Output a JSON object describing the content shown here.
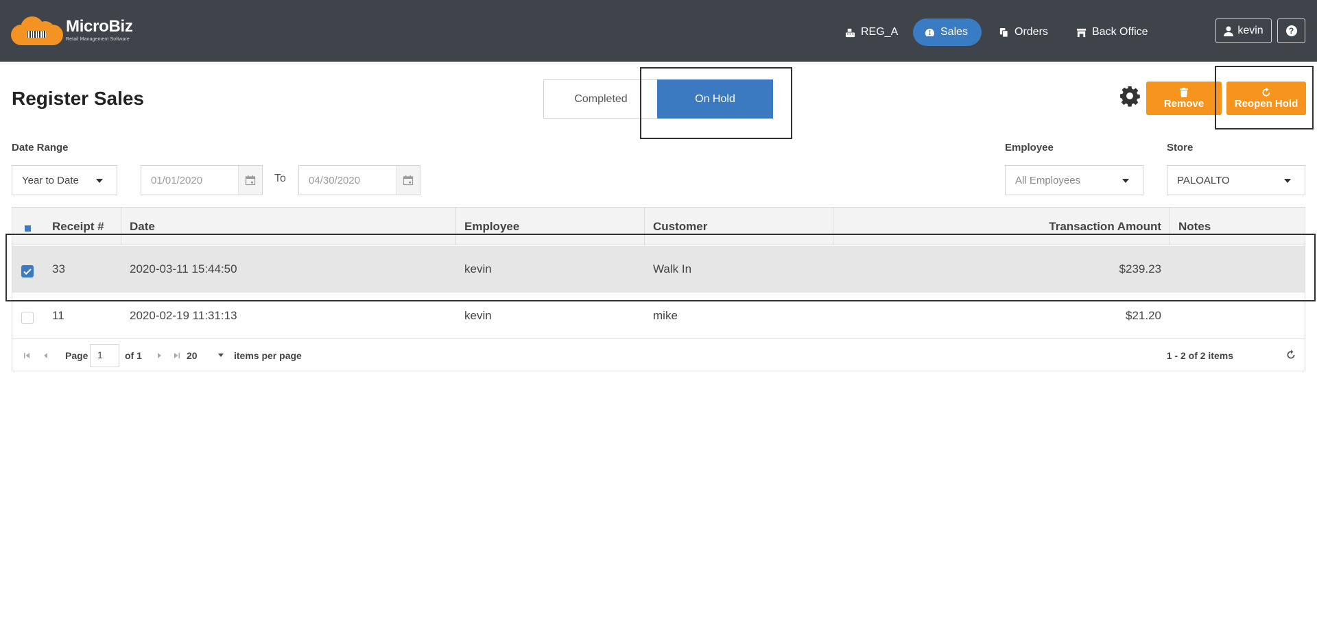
{
  "app": {
    "logo_name": "MicroBiz",
    "logo_tagline": "Retail Management Software"
  },
  "nav": {
    "register": "REG_A",
    "sales": "Sales",
    "orders": "Orders",
    "back_office": "Back Office",
    "user": "kevin",
    "help": "?"
  },
  "header": {
    "title": "Register Sales",
    "tabs": {
      "completed": "Completed",
      "on_hold": "On Hold",
      "active": "On Hold"
    },
    "remove_label": "Remove",
    "reopen_label": "Reopen Hold"
  },
  "filters": {
    "date_range_label": "Date Range",
    "date_range_value": "Year to Date",
    "from_date": "01/01/2020",
    "to_label": "To",
    "to_date": "04/30/2020",
    "employee_label": "Employee",
    "employee_value": "All Employees",
    "store_label": "Store",
    "store_value": "PALOALTO"
  },
  "table": {
    "columns": [
      "Receipt #",
      "Date",
      "Employee",
      "Customer",
      "Transaction Amount",
      "Notes"
    ],
    "rows": [
      {
        "selected": true,
        "receipt": "33",
        "date": "2020-03-11 15:44:50",
        "employee": "kevin",
        "customer": "Walk In",
        "amount": "$239.23",
        "notes": ""
      },
      {
        "selected": false,
        "receipt": "11",
        "date": "2020-02-19 11:31:13",
        "employee": "kevin",
        "customer": "mike",
        "amount": "$21.20",
        "notes": ""
      }
    ]
  },
  "pager": {
    "page_label": "Page",
    "page": "1",
    "of_label": "of 1",
    "page_size": "20",
    "items_per_page_label": "items per page",
    "count_label": "1 - 2 of 2 items"
  },
  "colors": {
    "topbar": "#3f444b",
    "accent_blue": "#3b79c1",
    "accent_orange": "#f7941e",
    "selected_row": "#e6e6e6"
  }
}
